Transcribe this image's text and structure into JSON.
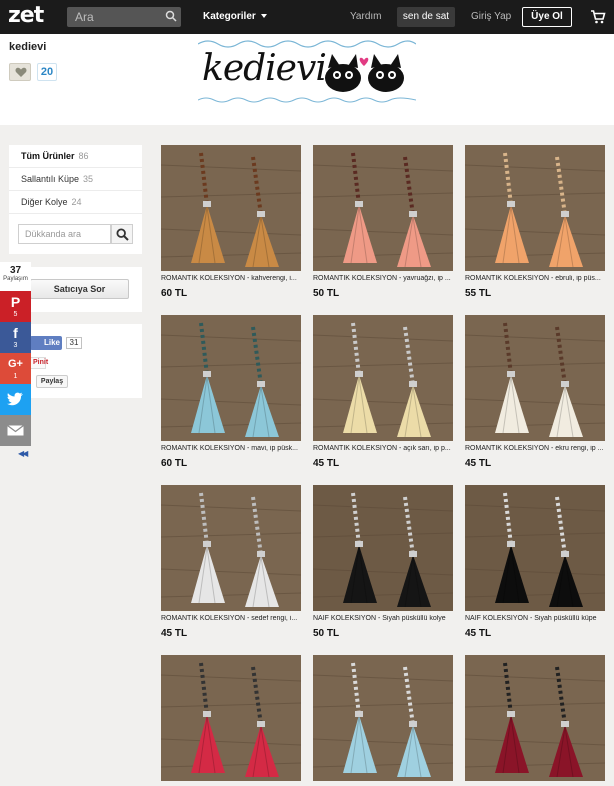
{
  "nav": {
    "logo": "zet",
    "search_placeholder": "Ara",
    "categories_label": "Kategoriler",
    "help_label": "Yardım",
    "sell_label": "sen de sat",
    "login_label": "Giriş Yap",
    "signup_label": "Üye Ol",
    "icons": [
      "search-icon",
      "chevron-down-icon",
      "cart-icon"
    ]
  },
  "shop": {
    "name": "kedievi",
    "favorite_count": "20",
    "banner_text": "kedievi"
  },
  "sidebar": {
    "categories": [
      {
        "label": "Tüm Ürünler",
        "count": "86"
      },
      {
        "label": "Sallantılı Küpe",
        "count": "35"
      },
      {
        "label": "Diğer Kolye",
        "count": "24"
      }
    ],
    "search_placeholder": "Dükkanda ara",
    "ask_seller_label": "Satıcıya Sor",
    "like_label": "Like",
    "like_count": "31",
    "pin_label": "Pinit",
    "share_label": "Paylaş"
  },
  "sharebar": {
    "total": "37",
    "total_label": "Paylaşım",
    "pinterest_count": "5",
    "facebook_count": "3",
    "googleplus_count": "1"
  },
  "colors": {
    "pinterest": "#cb2027",
    "facebook": "#3b5998",
    "googleplus": "#dd4b39",
    "twitter": "#1da1f2",
    "email": "#8c8c8c",
    "topbar": "#1b1b1b"
  },
  "products": [
    {
      "title": "ROMANTİK KOLEKSİYON - kahverengi, i...",
      "price": "60 TL",
      "color": "#c98a45",
      "bead": "#6b3a1f"
    },
    {
      "title": "ROMANTİK KOLEKSİYON - yavruağzı, ip ...",
      "price": "50 TL",
      "color": "#ef9a86",
      "bead": "#5a2a22"
    },
    {
      "title": "ROMANTİK KOLEKSİYON - ebruli, ip püs...",
      "price": "55 TL",
      "color": "#f0a36a",
      "bead": "#d8b48a"
    },
    {
      "title": "ROMANTİK KOLEKSİYON - mavi, ip püsk...",
      "price": "60 TL",
      "color": "#8cc7d8",
      "bead": "#2f5a5a"
    },
    {
      "title": "ROMANTİK KOLEKSİYON - açık sarı, ip p...",
      "price": "45 TL",
      "color": "#ecdca8",
      "bead": "#c9c9c9"
    },
    {
      "title": "ROMANTİK KOLEKSİYON - ekru rengi, ip ...",
      "price": "45 TL",
      "color": "#f1ece0",
      "bead": "#5a3a2a"
    },
    {
      "title": "ROMANTİK KOLEKSİYON - sedef rengi, i...",
      "price": "45 TL",
      "color": "#e6e6e6",
      "bead": "#bdbdbd"
    },
    {
      "title": "NAİF KOLEKSİYON - Siyah püsküllü kolye",
      "price": "50 TL",
      "color": "#151515",
      "bead": "#cfcfcf"
    },
    {
      "title": "NAİF KOLEKSİYON - Siyah püsküllü küpe",
      "price": "45 TL",
      "color": "#0d0d0d",
      "bead": "#d9d9d9"
    },
    {
      "title": "",
      "price": "",
      "color": "#d42a45",
      "bead": "#333333"
    },
    {
      "title": "",
      "price": "",
      "color": "#9fd0e0",
      "bead": "#d9d9d9"
    },
    {
      "title": "",
      "price": "",
      "color": "#8a1428",
      "bead": "#222222"
    }
  ]
}
